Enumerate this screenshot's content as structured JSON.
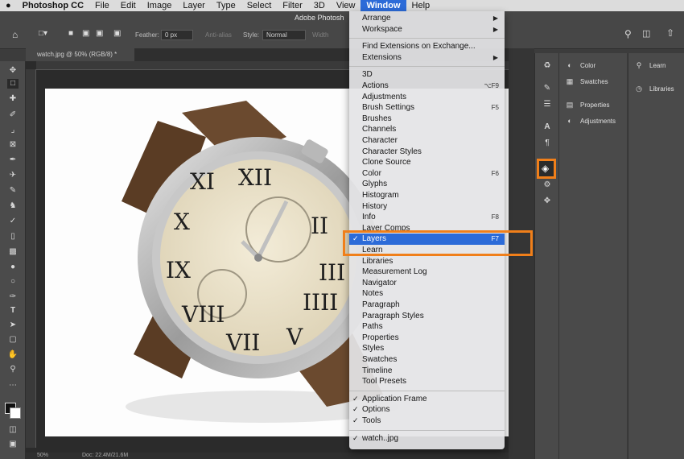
{
  "menubar": {
    "apple": "",
    "app_name": "Photoshop CC",
    "items": [
      "File",
      "Edit",
      "Image",
      "Layer",
      "Type",
      "Select",
      "Filter",
      "3D",
      "View",
      "Window",
      "Help"
    ]
  },
  "window_title": "Adobe Photosh",
  "options": {
    "feather_label": "Feather:",
    "feather_value": "0 px",
    "antialias_label": "Anti-alias",
    "style_label": "Style:",
    "style_value": "Normal",
    "width_label": "Width"
  },
  "document": {
    "tab_title": "watch.jpg @ 50% (RGB/8) *",
    "zoom": "50%",
    "doc_info": "Doc: 22.4M/21.6M"
  },
  "window_menu": {
    "items": [
      {
        "label": "Arrange",
        "submenu": true
      },
      {
        "label": "Workspace",
        "submenu": true
      },
      {
        "sep": true
      },
      {
        "label": "Find Extensions on Exchange..."
      },
      {
        "label": "Extensions",
        "submenu": true
      },
      {
        "sep": true
      },
      {
        "label": "3D"
      },
      {
        "label": "Actions",
        "shortcut": "⌥F9"
      },
      {
        "label": "Adjustments"
      },
      {
        "label": "Brush Settings",
        "shortcut": "F5"
      },
      {
        "label": "Brushes"
      },
      {
        "label": "Channels"
      },
      {
        "label": "Character"
      },
      {
        "label": "Character Styles"
      },
      {
        "label": "Clone Source"
      },
      {
        "label": "Color",
        "shortcut": "F6"
      },
      {
        "label": "Glyphs"
      },
      {
        "label": "Histogram"
      },
      {
        "label": "History"
      },
      {
        "label": "Info",
        "shortcut": "F8"
      },
      {
        "label": "Layer Comps"
      },
      {
        "label": "Layers",
        "shortcut": "F7",
        "checked": true,
        "highlighted": true
      },
      {
        "label": "Learn"
      },
      {
        "label": "Libraries"
      },
      {
        "label": "Measurement Log"
      },
      {
        "label": "Navigator"
      },
      {
        "label": "Notes"
      },
      {
        "label": "Paragraph"
      },
      {
        "label": "Paragraph Styles"
      },
      {
        "label": "Paths"
      },
      {
        "label": "Properties"
      },
      {
        "label": "Styles"
      },
      {
        "label": "Swatches"
      },
      {
        "label": "Timeline"
      },
      {
        "label": "Tool Presets"
      },
      {
        "sep": true
      },
      {
        "label": "Application Frame",
        "checked": true
      },
      {
        "label": "Options",
        "checked": true
      },
      {
        "label": "Tools",
        "checked": true
      },
      {
        "sep": true
      },
      {
        "label": "watch..jpg",
        "checked": true
      }
    ]
  },
  "panels": {
    "col1": [
      {
        "icon": "color-icon",
        "label": "Color"
      },
      {
        "icon": "swatches-icon",
        "label": "Swatches"
      },
      {
        "icon": "properties-icon",
        "label": "Properties"
      },
      {
        "icon": "adjustments-icon",
        "label": "Adjustments"
      }
    ],
    "col2": [
      {
        "icon": "learn-icon",
        "label": "Learn"
      },
      {
        "icon": "libraries-icon",
        "label": "Libraries"
      }
    ]
  },
  "colors": {
    "accent_highlight": "#2c6bd8",
    "callout_orange": "#f07f1a"
  }
}
